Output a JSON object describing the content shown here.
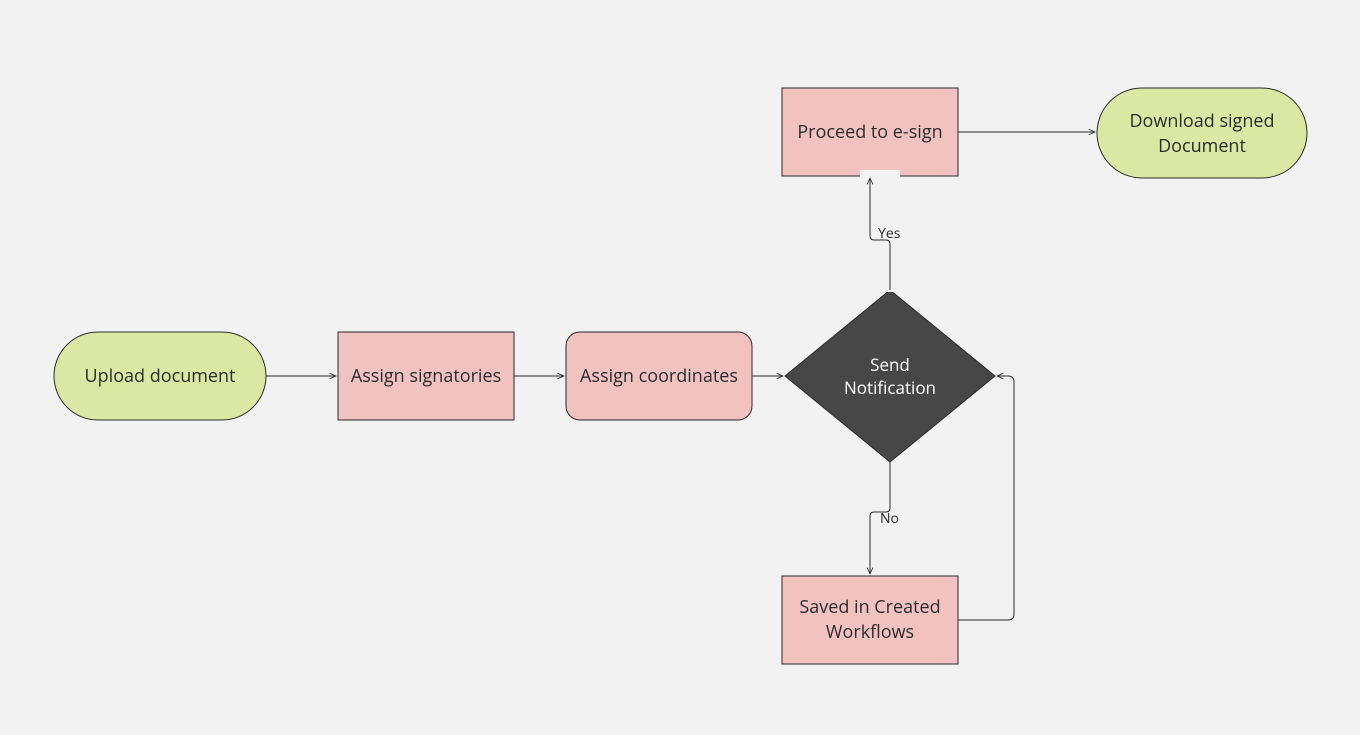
{
  "nodes": {
    "upload": {
      "label": "Upload document"
    },
    "assign_s": {
      "label": "Assign signatories"
    },
    "assign_c": {
      "label": "Assign coordinates"
    },
    "decision": {
      "line1": "Send",
      "line2": "Notification"
    },
    "proceed": {
      "label": "Proceed to e-sign"
    },
    "saved": {
      "line1": "Saved in Created",
      "line2": "Workflows"
    },
    "download": {
      "line1": "Download signed",
      "line2": "Document"
    }
  },
  "edges": {
    "yes": "Yes",
    "no": "No"
  }
}
